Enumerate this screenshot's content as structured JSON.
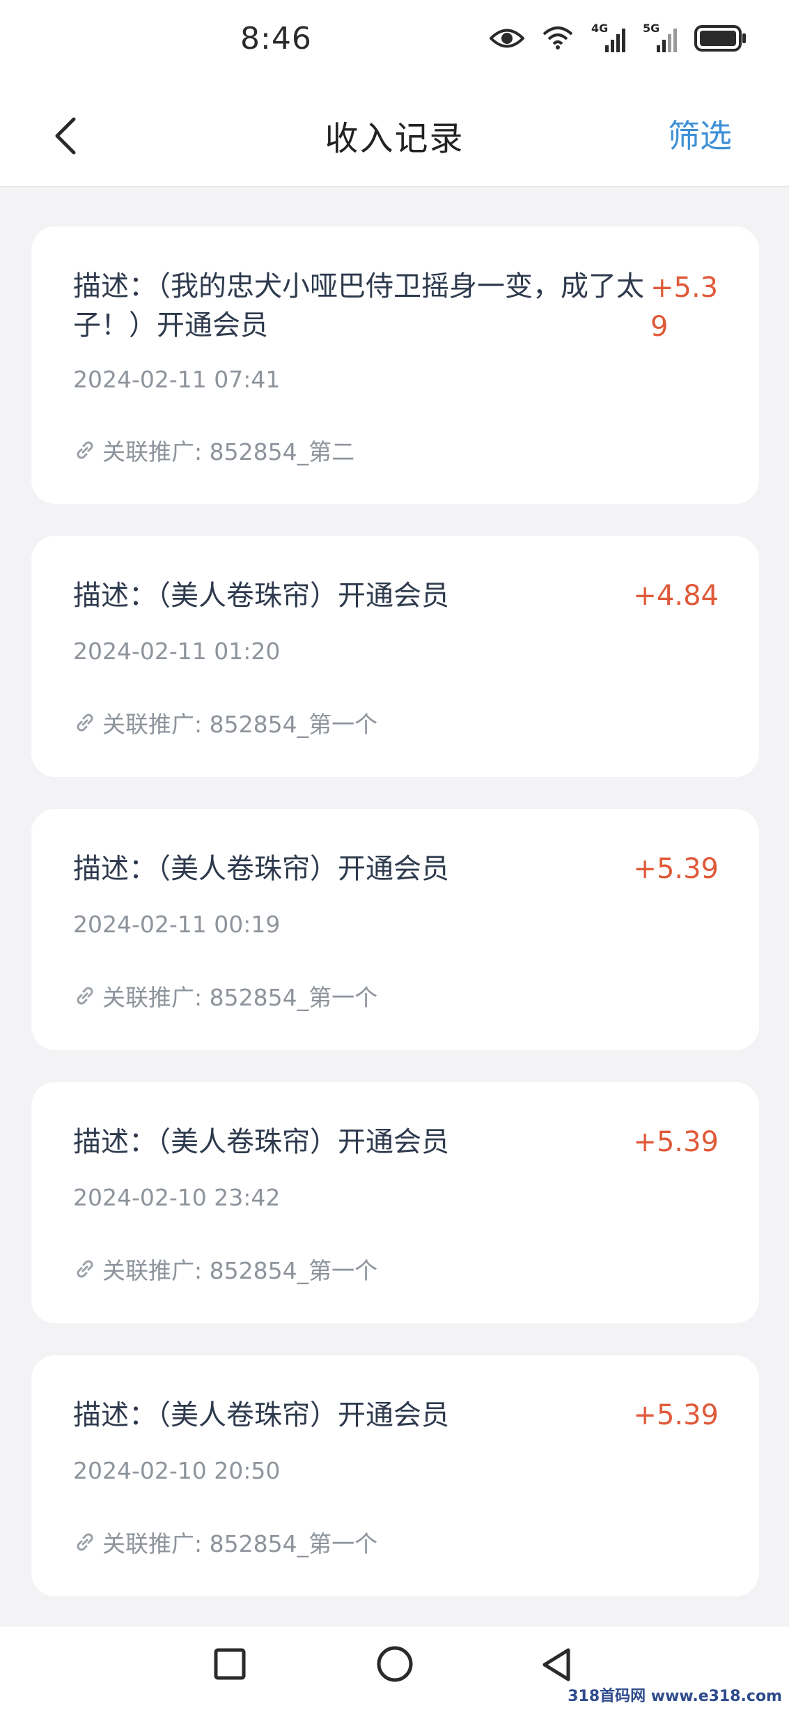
{
  "status_bar": {
    "time": "8:46",
    "net1": "4G",
    "net2": "5G"
  },
  "header": {
    "title": "收入记录",
    "filter_label": "筛选"
  },
  "records": [
    {
      "description": "描述：（我的忠犬小哑巴侍卫摇身一变，成了太子！）开通会员",
      "amount": "+5.39",
      "time": "2024-02-11 07:41",
      "promo": "关联推广: 852854_第二"
    },
    {
      "description": "描述：（美人卷珠帘）开通会员",
      "amount": "+4.84",
      "time": "2024-02-11 01:20",
      "promo": "关联推广: 852854_第一个"
    },
    {
      "description": "描述：（美人卷珠帘）开通会员",
      "amount": "+5.39",
      "time": "2024-02-11 00:19",
      "promo": "关联推广: 852854_第一个"
    },
    {
      "description": "描述：（美人卷珠帘）开通会员",
      "amount": "+5.39",
      "time": "2024-02-10 23:42",
      "promo": "关联推广: 852854_第一个"
    },
    {
      "description": "描述：（美人卷珠帘）开通会员",
      "amount": "+5.39",
      "time": "2024-02-10 20:50",
      "promo": "关联推广: 852854_第一个"
    }
  ],
  "watermark": "318首码网 www.e318.com",
  "colors": {
    "accent": "#3d8fd6",
    "amount": "#e05a3a",
    "muted": "#8e949c",
    "background": "#f3f3f5"
  }
}
